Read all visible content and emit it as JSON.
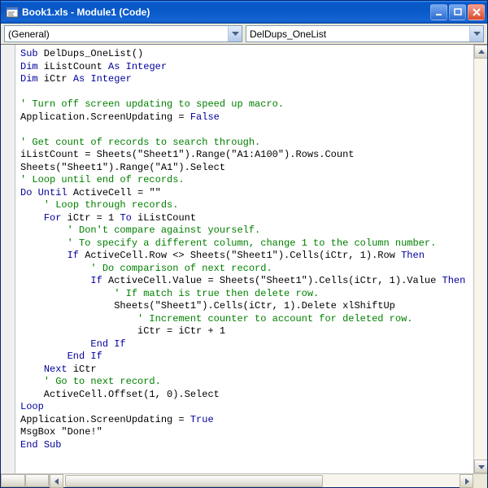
{
  "window": {
    "title": "Book1.xls - Module1 (Code)"
  },
  "dropdowns": {
    "object": "(General)",
    "proc": "DelDups_OneList"
  },
  "code": {
    "lines": [
      {
        "t": "kw",
        "i": 0,
        "x": "Sub DelDups_OneList()"
      },
      {
        "t": "kw",
        "i": 0,
        "x": "Dim iListCount As Integer"
      },
      {
        "t": "kw",
        "i": 0,
        "x": "Dim iCtr As Integer"
      },
      {
        "t": "",
        "i": 0,
        "x": ""
      },
      {
        "t": "cm",
        "i": 0,
        "x": "' Turn off screen updating to speed up macro."
      },
      {
        "t": "",
        "i": 0,
        "x": "Application.ScreenUpdating = False"
      },
      {
        "t": "",
        "i": 0,
        "x": ""
      },
      {
        "t": "cm",
        "i": 0,
        "x": "' Get count of records to search through."
      },
      {
        "t": "",
        "i": 0,
        "x": "iListCount = Sheets(\"Sheet1\").Range(\"A1:A100\").Rows.Count"
      },
      {
        "t": "",
        "i": 0,
        "x": "Sheets(\"Sheet1\").Range(\"A1\").Select"
      },
      {
        "t": "cm",
        "i": 0,
        "x": "' Loop until end of records."
      },
      {
        "t": "kw",
        "i": 0,
        "x": "Do Until ActiveCell = \"\""
      },
      {
        "t": "cm",
        "i": 1,
        "x": "' Loop through records."
      },
      {
        "t": "kw",
        "i": 1,
        "x": "For iCtr = 1 To iListCount"
      },
      {
        "t": "cm",
        "i": 2,
        "x": "' Don't compare against yourself."
      },
      {
        "t": "cm",
        "i": 2,
        "x": "' To specify a different column, change 1 to the column number."
      },
      {
        "t": "kw",
        "i": 2,
        "x": "If ActiveCell.Row <> Sheets(\"Sheet1\").Cells(iCtr, 1).Row Then"
      },
      {
        "t": "cm",
        "i": 3,
        "x": "' Do comparison of next record."
      },
      {
        "t": "kw",
        "i": 3,
        "x": "If ActiveCell.Value = Sheets(\"Sheet1\").Cells(iCtr, 1).Value Then"
      },
      {
        "t": "cm",
        "i": 4,
        "x": "' If match is true then delete row."
      },
      {
        "t": "",
        "i": 4,
        "x": "Sheets(\"Sheet1\").Cells(iCtr, 1).Delete xlShiftUp"
      },
      {
        "t": "cm",
        "i": 5,
        "x": "' Increment counter to account for deleted row."
      },
      {
        "t": "",
        "i": 5,
        "x": "iCtr = iCtr + 1"
      },
      {
        "t": "kw",
        "i": 3,
        "x": "End If"
      },
      {
        "t": "kw",
        "i": 2,
        "x": "End If"
      },
      {
        "t": "kw",
        "i": 1,
        "x": "Next iCtr"
      },
      {
        "t": "cm",
        "i": 1,
        "x": "' Go to next record."
      },
      {
        "t": "",
        "i": 1,
        "x": "ActiveCell.Offset(1, 0).Select"
      },
      {
        "t": "kw",
        "i": 0,
        "x": "Loop"
      },
      {
        "t": "",
        "i": 0,
        "x": "Application.ScreenUpdating = True"
      },
      {
        "t": "",
        "i": 0,
        "x": "MsgBox \"Done!\""
      },
      {
        "t": "kw",
        "i": 0,
        "x": "End Sub"
      }
    ]
  }
}
